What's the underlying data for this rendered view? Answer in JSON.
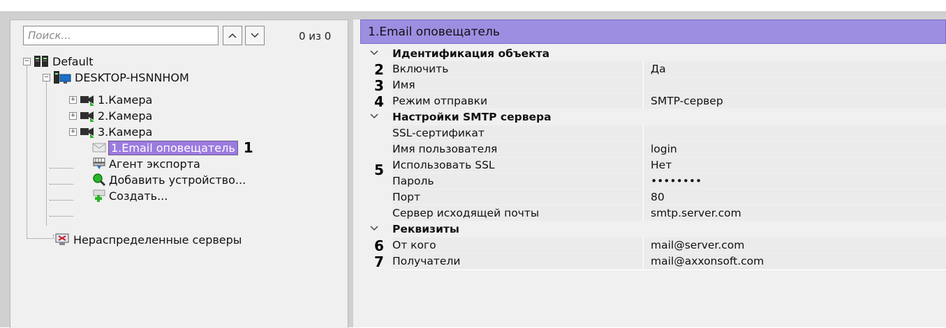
{
  "tree_panel": {
    "search": {
      "placeholder": "Поиск...",
      "value": ""
    },
    "match_count": "0 из 0",
    "items": [
      {
        "label": "Default"
      },
      {
        "label": "DESKTOP-HSNNHOM"
      },
      {
        "label": "1.Камера"
      },
      {
        "label": "2.Камера"
      },
      {
        "label": "3.Камера"
      },
      {
        "label": "1.Email оповещатель",
        "marker": "1"
      },
      {
        "label": "Агент экспорта"
      },
      {
        "label": "Добавить устройство..."
      },
      {
        "label": "Создать..."
      },
      {
        "label": "Нераспределенные серверы"
      }
    ]
  },
  "properties_panel": {
    "title": "1.Email оповещатель",
    "sections": [
      {
        "label": "Идентификация объекта",
        "rows": [
          {
            "marker": "2",
            "name": "Включить",
            "value": "Да"
          },
          {
            "marker": "3",
            "name": "Имя",
            "value": ""
          },
          {
            "marker": "4",
            "name": "Режим отправки",
            "value": "SMTP-сервер"
          }
        ]
      },
      {
        "label": "Настройки SMTP сервера",
        "group_marker": "5",
        "rows": [
          {
            "name": "SSL-сертификат",
            "value": ""
          },
          {
            "name": "Имя пользователя",
            "value": "login"
          },
          {
            "name": "Использовать SSL",
            "value": "Нет"
          },
          {
            "name": "Пароль",
            "value": "••••••••"
          },
          {
            "name": "Порт",
            "value": "80"
          },
          {
            "name": "Сервер исходящей почты",
            "value": "smtp.server.com"
          }
        ]
      },
      {
        "label": "Реквизиты",
        "rows": [
          {
            "marker": "6",
            "name": "От кого",
            "value": "mail@server.com"
          },
          {
            "marker": "7",
            "name": "Получатели",
            "value": "mail@axxonsoft.com"
          }
        ]
      }
    ]
  },
  "colors": {
    "title_bar": "#9e8ee2",
    "selection": "#9c7be0",
    "panel_bg": "#f0f0f0",
    "frame": "#d0d0d0"
  }
}
